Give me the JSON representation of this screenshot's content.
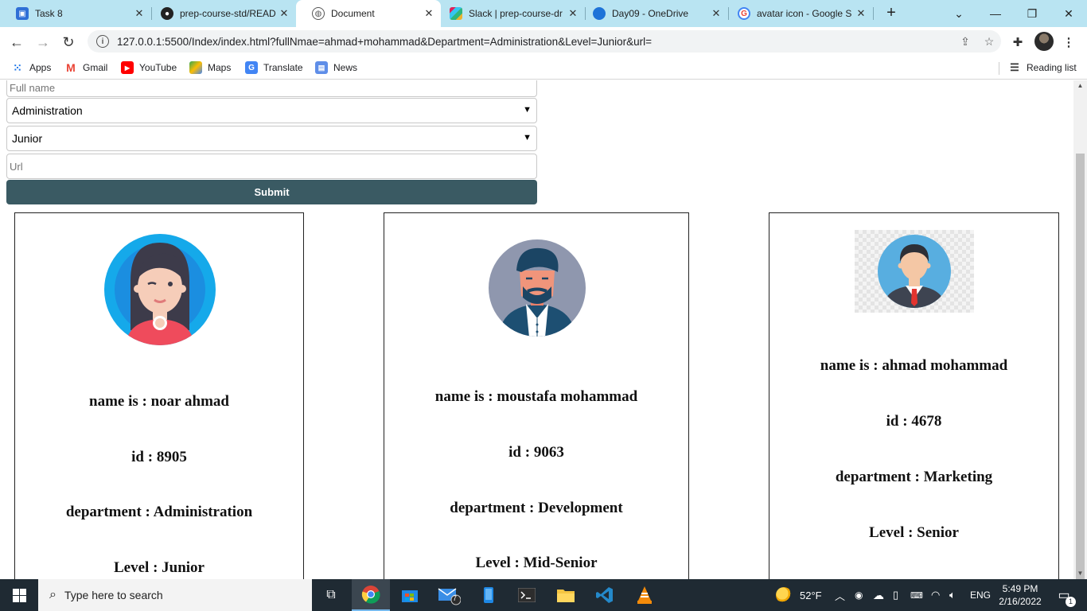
{
  "browser": {
    "tabs": [
      {
        "title": "Task 8",
        "active": false
      },
      {
        "title": "prep-course-std/READ",
        "active": false
      },
      {
        "title": "Document",
        "active": true
      },
      {
        "title": "Slack | prep-course-dr",
        "active": false
      },
      {
        "title": "Day09 - OneDrive",
        "active": false
      },
      {
        "title": "avatar icon - Google S",
        "active": false
      }
    ],
    "url": "127.0.0.1:5500/Index/index.html?fullNmae=ahmad+mohammad&Department=Administration&Level=Junior&url=",
    "bookmarks": [
      "Apps",
      "Gmail",
      "YouTube",
      "Maps",
      "Translate",
      "News"
    ],
    "reading_list": "Reading list"
  },
  "form": {
    "fullname_placeholder": "Full name",
    "department_value": "Administration",
    "level_value": "Junior",
    "url_placeholder": "Url",
    "submit_label": "Submit"
  },
  "cards": [
    {
      "name": "name is : noar ahmad",
      "id": "id : 8905",
      "department": "department : Administration",
      "level": "Level : Junior",
      "avatar": "woman-avatar-icon"
    },
    {
      "name": "name is : moustafa mohammad",
      "id": "id : 9063",
      "department": "department : Development",
      "level": "Level : Mid-Senior",
      "avatar": "bearded-man-avatar-icon"
    },
    {
      "name": "name is : ahmad mohammad",
      "id": "id : 4678",
      "department": "department : Marketing",
      "level": "Level : Senior",
      "avatar": "businessman-avatar-icon"
    }
  ],
  "taskbar": {
    "search_placeholder": "Type here to search",
    "weather": "52°F",
    "language": "ENG",
    "time": "5:49 PM",
    "date": "2/16/2022",
    "mail_badge": "7",
    "notification_count": "1"
  },
  "colors": {
    "tabstrip": "#b9e4f2",
    "submit": "#3a5a63",
    "taskbar": "#1f2a33"
  }
}
